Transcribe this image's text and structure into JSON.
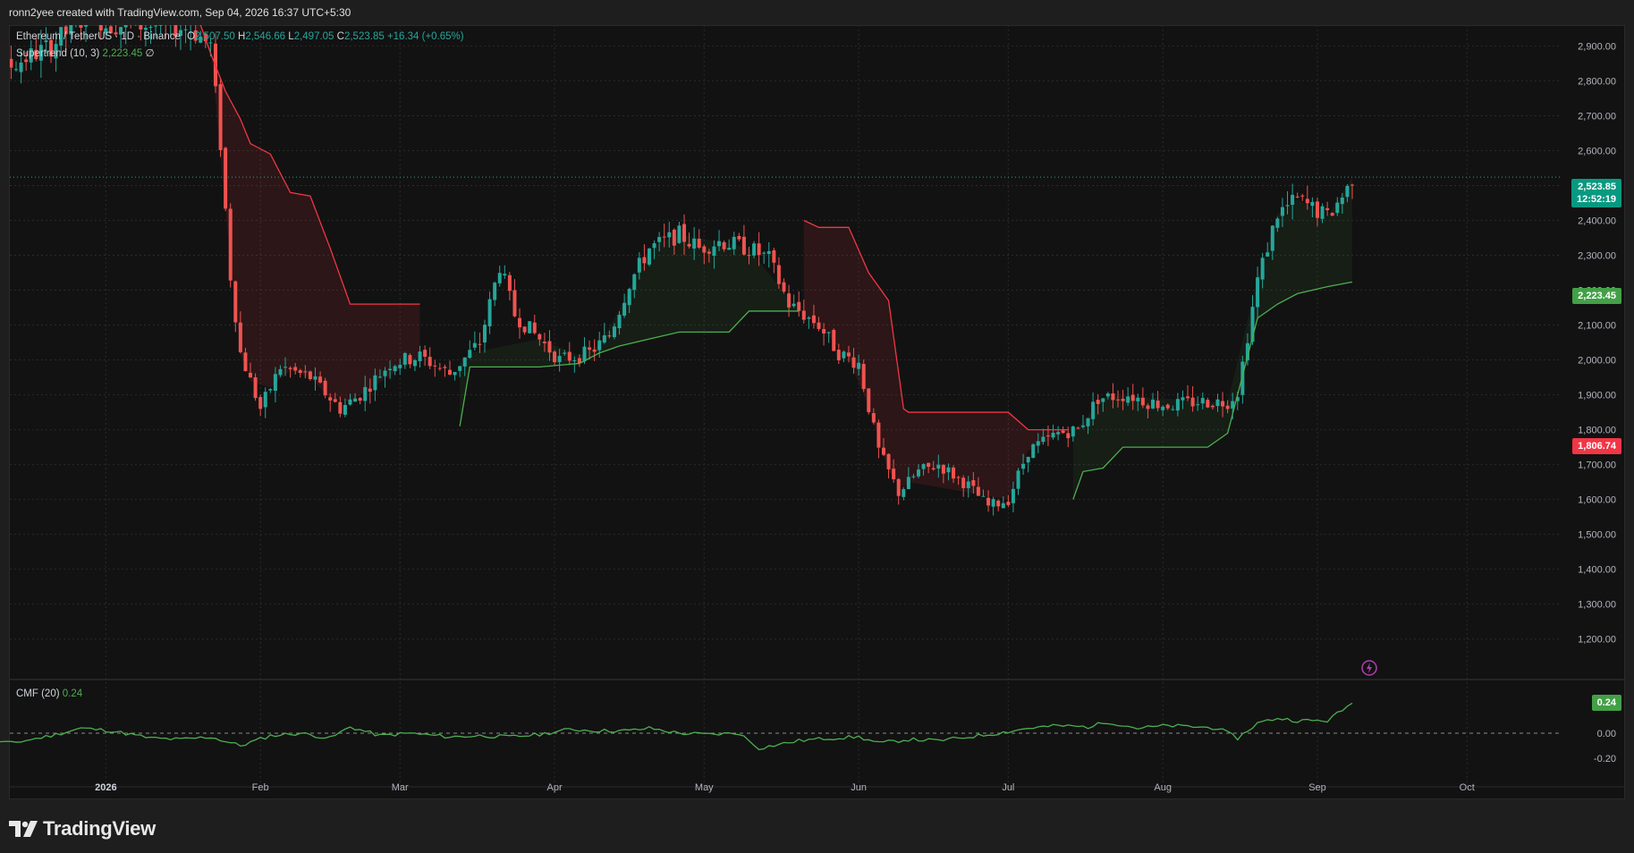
{
  "header": {
    "attribution": "ronn2yee created with TradingView.com, Sep 04, 2026 16:37 UTC+5:30"
  },
  "legend": {
    "symbol": "Ethereum / TetherUS · 1D · Binance",
    "o_label": "O",
    "o_value": "2,507.50",
    "h_label": "H",
    "h_value": "2,546.66",
    "l_label": "L",
    "l_value": "2,497.05",
    "c_label": "C",
    "c_value": "2,523.85",
    "change": "+16.34 (+0.65%)",
    "supertrend_label": "Supertrend (10, 3)",
    "supertrend_value": "2,223.45",
    "supertrend_suffix": "∅",
    "cmf_label": "CMF (20)",
    "cmf_value": "0.24"
  },
  "price_tags": {
    "last_price": "2,523.85",
    "countdown": "12:52:19",
    "supertrend": "2,223.45",
    "stop_level": "1,806.74",
    "cmf": "0.24"
  },
  "colors": {
    "up": "#26a69a",
    "down": "#ef5350",
    "st_up": "#4caf50",
    "st_down": "#f23645",
    "cmf": "#4caf50",
    "grid": "#2a2a2a"
  },
  "footer": {
    "brand": "TradingView",
    "logo_icon": "tradingview-logo-icon"
  },
  "chart_data": {
    "type": "candlestick",
    "symbol": "ETHUSDT",
    "timeframe": "1D",
    "ylim": [
      1130,
      2960
    ],
    "yticks": [
      "2,900.00",
      "2,800.00",
      "2,700.00",
      "2,600.00",
      "2,500.00",
      "2,400.00",
      "2,300.00",
      "2,200.00",
      "2,100.00",
      "2,000.00",
      "1,900.00",
      "1,800.00",
      "1,700.00",
      "1,600.00",
      "1,500.00",
      "1,400.00",
      "1,300.00",
      "1,200.00"
    ],
    "ytick_values": [
      2900,
      2800,
      2700,
      2600,
      2500,
      2400,
      2300,
      2200,
      2100,
      2000,
      1900,
      1800,
      1700,
      1600,
      1500,
      1400,
      1300,
      1200
    ],
    "xticks": [
      "2026",
      "Feb",
      "Mar",
      "Apr",
      "May",
      "Jun",
      "Jul",
      "Aug",
      "Sep",
      "Oct"
    ],
    "xtick_day_index": [
      31,
      62,
      90,
      121,
      151,
      182,
      212,
      243,
      274,
      304
    ],
    "start_date": "2025-12-01",
    "anchors": [
      [
        0,
        2880
      ],
      [
        5,
        2850
      ],
      [
        10,
        2830
      ],
      [
        20,
        2900
      ],
      [
        28,
        3000
      ],
      [
        31,
        2960
      ],
      [
        40,
        2960
      ],
      [
        48,
        2950
      ],
      [
        52,
        2900
      ],
      [
        54,
        2620
      ],
      [
        56,
        2240
      ],
      [
        58,
        2020
      ],
      [
        62,
        1860
      ],
      [
        66,
        1980
      ],
      [
        72,
        1950
      ],
      [
        78,
        1860
      ],
      [
        82,
        1900
      ],
      [
        88,
        1990
      ],
      [
        94,
        2010
      ],
      [
        100,
        1960
      ],
      [
        106,
        2050
      ],
      [
        110,
        2270
      ],
      [
        113,
        2130
      ],
      [
        118,
        2060
      ],
      [
        122,
        2000
      ],
      [
        128,
        2020
      ],
      [
        132,
        2070
      ],
      [
        136,
        2220
      ],
      [
        140,
        2320
      ],
      [
        146,
        2360
      ],
      [
        150,
        2320
      ],
      [
        154,
        2340
      ],
      [
        160,
        2320
      ],
      [
        164,
        2290
      ],
      [
        168,
        2160
      ],
      [
        174,
        2100
      ],
      [
        178,
        2020
      ],
      [
        182,
        1990
      ],
      [
        186,
        1740
      ],
      [
        190,
        1620
      ],
      [
        194,
        1680
      ],
      [
        198,
        1700
      ],
      [
        204,
        1640
      ],
      [
        208,
        1580
      ],
      [
        212,
        1600
      ],
      [
        216,
        1740
      ],
      [
        222,
        1790
      ],
      [
        226,
        1800
      ],
      [
        230,
        1890
      ],
      [
        236,
        1900
      ],
      [
        240,
        1880
      ],
      [
        244,
        1870
      ],
      [
        250,
        1880
      ],
      [
        256,
        1880
      ],
      [
        258,
        1910
      ],
      [
        262,
        2230
      ],
      [
        266,
        2420
      ],
      [
        270,
        2460
      ],
      [
        276,
        2410
      ],
      [
        280,
        2490
      ],
      [
        281,
        2523.85
      ]
    ],
    "supertrend_segments": [
      {
        "trend": "down",
        "points": [
          [
            49,
            3000
          ],
          [
            52,
            2880
          ],
          [
            55,
            2770
          ],
          [
            58,
            2690
          ],
          [
            60,
            2620
          ],
          [
            64,
            2590
          ],
          [
            68,
            2480
          ],
          [
            72,
            2470
          ],
          [
            76,
            2320
          ],
          [
            80,
            2160
          ],
          [
            94,
            2160
          ]
        ]
      },
      {
        "trend": "up",
        "points": [
          [
            102,
            1810
          ],
          [
            104,
            1980
          ],
          [
            118,
            1980
          ],
          [
            126,
            1990
          ],
          [
            130,
            2020
          ],
          [
            134,
            2040
          ],
          [
            140,
            2060
          ],
          [
            146,
            2080
          ],
          [
            156,
            2080
          ],
          [
            160,
            2140
          ],
          [
            170,
            2140
          ]
        ]
      },
      {
        "trend": "down",
        "points": [
          [
            171,
            2400
          ],
          [
            174,
            2380
          ],
          [
            180,
            2380
          ],
          [
            184,
            2250
          ],
          [
            188,
            2170
          ],
          [
            191,
            1860
          ],
          [
            192,
            1850
          ],
          [
            212,
            1850
          ],
          [
            216,
            1800
          ],
          [
            224,
            1800
          ]
        ]
      },
      {
        "trend": "up",
        "points": [
          [
            225,
            1600
          ],
          [
            227,
            1680
          ],
          [
            231,
            1690
          ],
          [
            235,
            1750
          ],
          [
            252,
            1750
          ],
          [
            256,
            1790
          ],
          [
            262,
            2120
          ],
          [
            266,
            2160
          ],
          [
            270,
            2190
          ],
          [
            276,
            2210
          ],
          [
            281,
            2223.45
          ]
        ]
      }
    ],
    "last_close": 2523.85,
    "stop_level": 1806.74,
    "supertrend_last": 2223.45,
    "cmf": {
      "ylim": [
        -0.3,
        0.2
      ],
      "yticks": [
        "0.00",
        "-0.20"
      ],
      "ytick_values": [
        0.0,
        -0.2
      ],
      "anchors": [
        [
          0,
          0.02
        ],
        [
          5,
          -0.05
        ],
        [
          12,
          -0.08
        ],
        [
          20,
          -0.02
        ],
        [
          26,
          0.04
        ],
        [
          32,
          0.02
        ],
        [
          40,
          -0.04
        ],
        [
          46,
          -0.05
        ],
        [
          52,
          -0.03
        ],
        [
          58,
          -0.1
        ],
        [
          64,
          -0.02
        ],
        [
          70,
          0.0
        ],
        [
          76,
          -0.04
        ],
        [
          80,
          0.05
        ],
        [
          86,
          -0.02
        ],
        [
          92,
          0.0
        ],
        [
          100,
          -0.03
        ],
        [
          106,
          -0.02
        ],
        [
          112,
          -0.03
        ],
        [
          118,
          -0.01
        ],
        [
          124,
          0.03
        ],
        [
          130,
          0.02
        ],
        [
          136,
          0.02
        ],
        [
          140,
          0.04
        ],
        [
          146,
          0.0
        ],
        [
          152,
          -0.01
        ],
        [
          158,
          0.0
        ],
        [
          162,
          -0.12
        ],
        [
          170,
          -0.06
        ],
        [
          176,
          -0.04
        ],
        [
          182,
          -0.03
        ],
        [
          186,
          -0.08
        ],
        [
          192,
          -0.05
        ],
        [
          198,
          -0.06
        ],
        [
          204,
          -0.03
        ],
        [
          210,
          0.0
        ],
        [
          216,
          0.04
        ],
        [
          222,
          0.06
        ],
        [
          228,
          0.05
        ],
        [
          232,
          0.09
        ],
        [
          238,
          0.04
        ],
        [
          244,
          0.06
        ],
        [
          250,
          0.05
        ],
        [
          254,
          0.04
        ],
        [
          258,
          -0.04
        ],
        [
          262,
          0.08
        ],
        [
          266,
          0.12
        ],
        [
          270,
          0.1
        ],
        [
          276,
          0.1
        ],
        [
          281,
          0.24
        ]
      ]
    }
  }
}
